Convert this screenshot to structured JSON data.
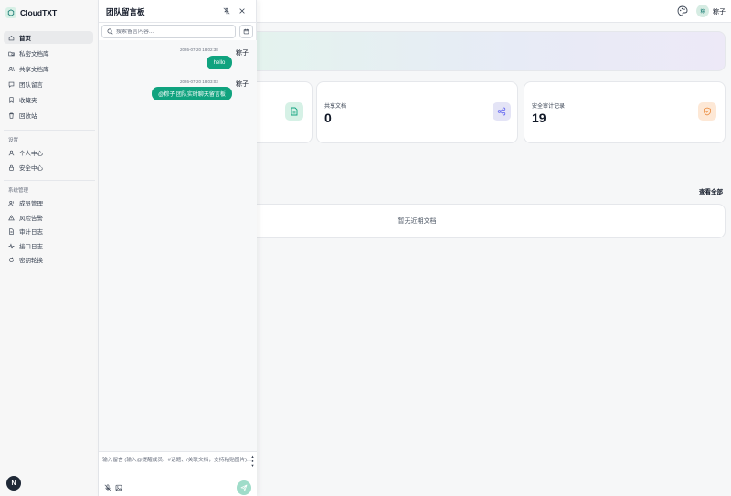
{
  "app": {
    "name": "CloudTXT",
    "logo_icon": "hexagon-icon"
  },
  "sidebar": {
    "items": [
      {
        "label": "首页",
        "icon": "home-icon",
        "active": true
      },
      {
        "label": "私密文档库",
        "icon": "folder-lock-icon"
      },
      {
        "label": "共享文档库",
        "icon": "users-icon"
      },
      {
        "label": "团队留言",
        "icon": "message-icon"
      },
      {
        "label": "收藏夹",
        "icon": "bookmark-icon"
      },
      {
        "label": "回收站",
        "icon": "trash-icon"
      }
    ],
    "settings_title": "设置",
    "settings_items": [
      {
        "label": "个人中心",
        "icon": "user-icon"
      },
      {
        "label": "安全中心",
        "icon": "lock-icon"
      }
    ],
    "admin_title": "系统管理",
    "admin_items": [
      {
        "label": "成员管理",
        "icon": "users-icon"
      },
      {
        "label": "风险告警",
        "icon": "alert-icon"
      },
      {
        "label": "审计日志",
        "icon": "file-text-icon"
      },
      {
        "label": "接口日志",
        "icon": "activity-icon"
      },
      {
        "label": "密钥轮换",
        "icon": "rotate-icon"
      }
    ],
    "footer_badge": "N"
  },
  "header": {
    "avatar_text": "粽",
    "username": "粽子"
  },
  "stats": [
    {
      "label": "",
      "value": "",
      "icon": "file-icon",
      "color": "#10a37f"
    },
    {
      "label": "共享文档",
      "value": "0",
      "icon": "share-icon",
      "color": "#6366f1"
    },
    {
      "label": "安全审计记录",
      "value": "19",
      "icon": "shield-check-icon",
      "color": "#ea8a3c"
    }
  ],
  "recent": {
    "view_all": "查看全部",
    "empty_text": "暂无近期文档"
  },
  "message_board": {
    "title": "团队留言板",
    "search_placeholder": "搜索留言内容...",
    "messages": [
      {
        "time": "2026-07-20 18:02:38",
        "author": "粽子",
        "text": "hello"
      },
      {
        "time": "2026-07-20 18:03:03",
        "author": "粽子",
        "text": "@粽子 团队实时聊天留言板"
      }
    ],
    "composer_placeholder": "输入留言 (输入@提醒成员、#话题、/关联文档，支持粘贴图片)..."
  },
  "colors": {
    "accent": "#10a37f",
    "sidebar_bg": "#f7f7f7",
    "active_bg": "#e9eaec"
  }
}
